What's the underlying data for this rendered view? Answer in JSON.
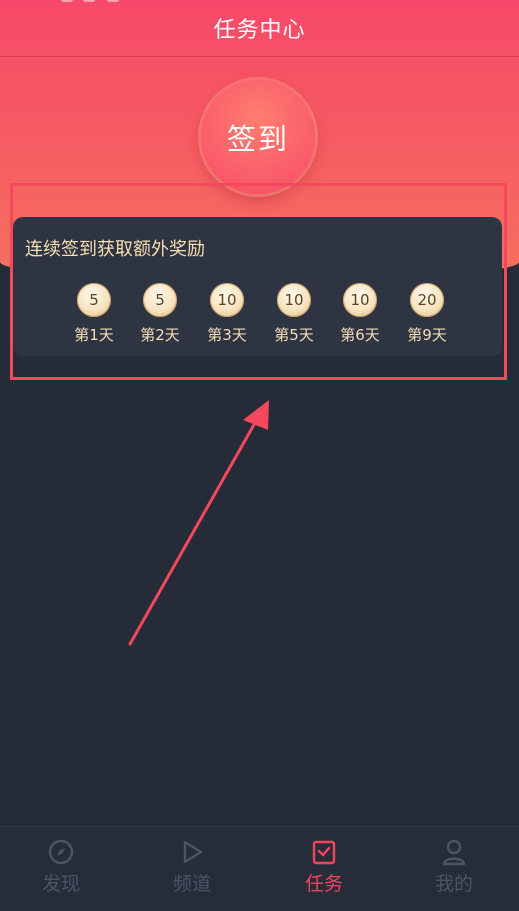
{
  "header": {
    "title": "任务中心"
  },
  "signin": {
    "label": "签到"
  },
  "streak": {
    "title": "连续签到获取额外奖励",
    "days": [
      {
        "reward": "5",
        "label": "第1天"
      },
      {
        "reward": "5",
        "label": "第2天"
      },
      {
        "reward": "10",
        "label": "第3天"
      },
      {
        "reward": "10",
        "label": "第5天"
      },
      {
        "reward": "10",
        "label": "第6天"
      },
      {
        "reward": "20",
        "label": "第9天"
      }
    ]
  },
  "tabbar": {
    "items": [
      {
        "label": "发现",
        "icon": "compass-icon",
        "active": false
      },
      {
        "label": "频道",
        "icon": "play-icon",
        "active": false
      },
      {
        "label": "任务",
        "icon": "task-icon",
        "active": true
      },
      {
        "label": "我的",
        "icon": "user-icon",
        "active": false
      }
    ]
  },
  "colors": {
    "accent": "#f2455d",
    "background": "#262b38",
    "gold_text": "#f6dfb1"
  }
}
